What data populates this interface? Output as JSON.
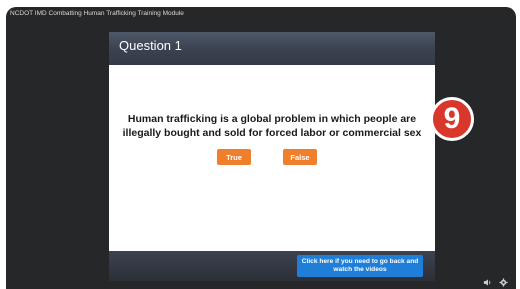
{
  "player": {
    "title": "NCDOT IMD Combatting Human Trafficking Training Module"
  },
  "slide": {
    "header": "Question 1",
    "question": "Human trafficking is a global problem in which people are illegally bought and sold for forced labor or commercial sex",
    "answers": [
      "True",
      "False"
    ],
    "videos_button": "Click here if you need to go back and watch the videos"
  },
  "badge": "9",
  "controls": {
    "icons": [
      "volume-icon",
      "settings-icon"
    ]
  },
  "colors": {
    "answer_button": "#f07f2c",
    "videos_button": "#1f7fd8",
    "badge": "#d9372c",
    "player_background": "#262729"
  }
}
